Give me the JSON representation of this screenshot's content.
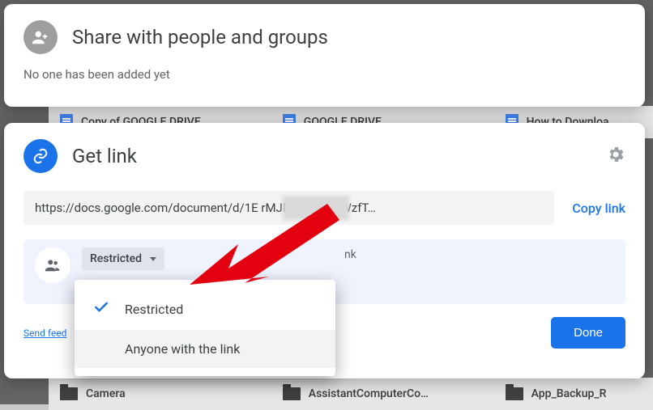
{
  "background": {
    "row_top": [
      {
        "name": "Copy of GOOGLE DRIVE"
      },
      {
        "name": "GOOGLE DRIVE"
      },
      {
        "name": "How to Downloa"
      }
    ],
    "row_bottom": [
      {
        "name": "Camera"
      },
      {
        "name": "AssistantComputerCo…"
      },
      {
        "name": "App_Backup_R"
      }
    ]
  },
  "share_card": {
    "title": "Share with people and groups",
    "subtitle": "No one has been added yet"
  },
  "getlink_card": {
    "title": "Get link",
    "url_display": "https://docs.google.com/document/d/1E             rMJDeXR4SX9WzfT…",
    "copy_label": "Copy link",
    "access_selected": "Restricted",
    "access_hint": "nk",
    "feedback_label": "Send feed",
    "done_label": "Done"
  },
  "dropdown": {
    "options": [
      {
        "label": "Restricted",
        "checked": true
      },
      {
        "label": "Anyone with the link",
        "checked": false
      }
    ]
  }
}
